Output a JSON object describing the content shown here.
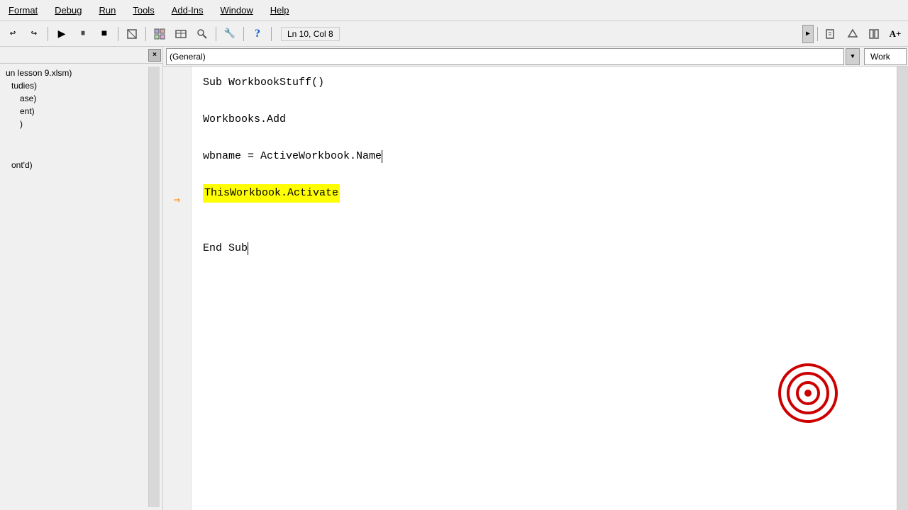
{
  "menubar": {
    "items": [
      "Format",
      "Debug",
      "Run",
      "Tools",
      "Add-Ins",
      "Window",
      "Help"
    ]
  },
  "toolbar": {
    "buttons": [
      {
        "name": "undo-btn",
        "icon": "↩",
        "label": "Undo"
      },
      {
        "name": "redo-btn",
        "icon": "↪",
        "label": "Redo"
      },
      {
        "name": "run-btn",
        "icon": "▶",
        "label": "Run"
      },
      {
        "name": "pause-btn",
        "icon": "⏸",
        "label": "Pause"
      },
      {
        "name": "stop-btn",
        "icon": "■",
        "label": "Stop"
      },
      {
        "name": "design-btn",
        "icon": "✏",
        "label": "Design"
      },
      {
        "name": "projectex-btn",
        "icon": "⊞",
        "label": "Project Explorer"
      },
      {
        "name": "properties-btn",
        "icon": "📋",
        "label": "Properties"
      },
      {
        "name": "object-btn",
        "icon": "📦",
        "label": "Object"
      },
      {
        "name": "tools-btn",
        "icon": "🔧",
        "label": "Tools"
      },
      {
        "name": "help-btn",
        "icon": "?",
        "label": "Help"
      }
    ],
    "status": "Ln 10, Col 8",
    "expand_icon": "▶"
  },
  "sidebar": {
    "close_label": "×",
    "items": [
      {
        "label": "un lesson 9.xlsm)",
        "indent": 0
      },
      {
        "label": "tudies)",
        "indent": 1
      },
      {
        "label": "ase)",
        "indent": 2
      },
      {
        "label": "ent)",
        "indent": 2
      },
      {
        "label": ")",
        "indent": 2
      },
      {
        "label": "ont'd)",
        "indent": 1
      }
    ]
  },
  "dropdown": {
    "left_value": "(General)",
    "right_value": "Work",
    "arrow": "▼"
  },
  "code": {
    "lines": [
      {
        "text": "Sub WorkbookStuff()",
        "type": "normal",
        "indent": ""
      },
      {
        "text": "",
        "type": "blank"
      },
      {
        "text": "Workbooks.Add",
        "type": "normal",
        "indent": ""
      },
      {
        "text": "",
        "type": "blank"
      },
      {
        "text": "wbname = ActiveWorkbook.Name",
        "type": "normal",
        "indent": ""
      },
      {
        "text": "",
        "type": "blank"
      },
      {
        "text": "ThisWorkbook.Activate",
        "type": "highlighted",
        "indent": "",
        "has_arrow": true
      },
      {
        "text": "",
        "type": "blank"
      },
      {
        "text": "",
        "type": "blank"
      },
      {
        "text": "End Sub",
        "type": "cursor",
        "indent": ""
      }
    ],
    "arrow_row": 6
  },
  "right_panel": {
    "label": "Work"
  }
}
